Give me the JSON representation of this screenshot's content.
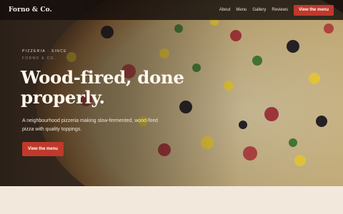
{
  "header": {
    "brand": "Forno & Co.",
    "nav": [
      {
        "label": "About"
      },
      {
        "label": "Menu"
      },
      {
        "label": "Gallery"
      },
      {
        "label": "Reviews"
      }
    ],
    "cta_label": "View the menu"
  },
  "hero": {
    "eyebrow": "Pizzeria · Since",
    "eyebrow_ghost": "Forno & Co.",
    "headline": "Wood-fired, done properly.",
    "subline": "A neighbourhood pizzeria making slow-fermented, wood-fired pizza with quality toppings.",
    "cta_label": "View the menu"
  },
  "colors": {
    "accent": "#c0392b",
    "topbar": "#140e0b",
    "page_background": "#f2e9dc"
  },
  "icons": {
    "hero_image": "pizza-photo"
  }
}
